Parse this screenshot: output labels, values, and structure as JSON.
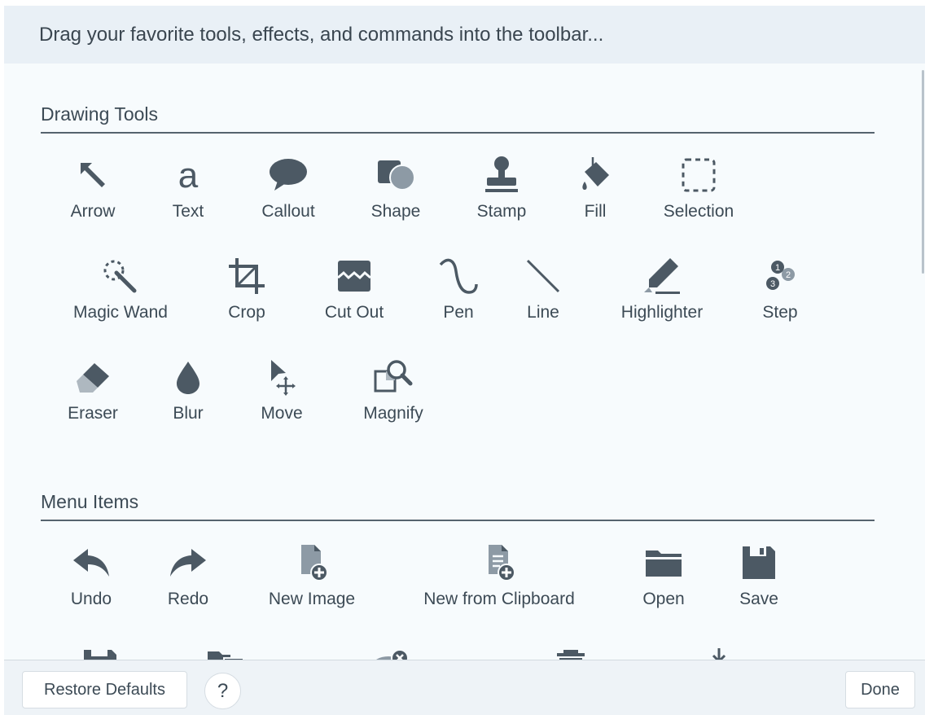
{
  "header": {
    "text": "Drag your favorite tools, effects, and commands into the toolbar..."
  },
  "sections": {
    "drawing": {
      "title": "Drawing Tools"
    },
    "menu": {
      "title": "Menu Items"
    }
  },
  "drawing_tools": [
    {
      "label": "Arrow",
      "icon": "arrow-icon"
    },
    {
      "label": "Text",
      "icon": "text-icon"
    },
    {
      "label": "Callout",
      "icon": "callout-icon"
    },
    {
      "label": "Shape",
      "icon": "shape-icon"
    },
    {
      "label": "Stamp",
      "icon": "stamp-icon"
    },
    {
      "label": "Fill",
      "icon": "fill-icon"
    },
    {
      "label": "Selection",
      "icon": "selection-icon"
    },
    {
      "label": "Magic Wand",
      "icon": "magic-wand-icon"
    },
    {
      "label": "Crop",
      "icon": "crop-icon"
    },
    {
      "label": "Cut Out",
      "icon": "cut-out-icon"
    },
    {
      "label": "Pen",
      "icon": "pen-icon"
    },
    {
      "label": "Line",
      "icon": "line-icon"
    },
    {
      "label": "Highlighter",
      "icon": "highlighter-icon"
    },
    {
      "label": "Step",
      "icon": "step-icon"
    },
    {
      "label": "Eraser",
      "icon": "eraser-icon"
    },
    {
      "label": "Blur",
      "icon": "blur-icon"
    },
    {
      "label": "Move",
      "icon": "move-icon"
    },
    {
      "label": "Magnify",
      "icon": "magnify-icon"
    }
  ],
  "menu_items": [
    {
      "label": "Undo",
      "icon": "undo-icon"
    },
    {
      "label": "Redo",
      "icon": "redo-icon"
    },
    {
      "label": "New Image",
      "icon": "new-image-icon"
    },
    {
      "label": "New from Clipboard",
      "icon": "new-from-clipboard-icon"
    },
    {
      "label": "Open",
      "icon": "folder-icon"
    },
    {
      "label": "Save",
      "icon": "save-icon"
    }
  ],
  "partial_icons": [
    "save-as-icon",
    "folder-copy-icon",
    "delete-cloud-icon",
    "trash-icon",
    "download-icon"
  ],
  "footer": {
    "restore_label": "Restore Defaults",
    "help_label": "?",
    "done_label": "Done"
  },
  "colors": {
    "icon": "#4c5964",
    "text": "#3c4a55",
    "header_bg": "#e9f0f6",
    "panel_bg": "#f7fbfd"
  }
}
